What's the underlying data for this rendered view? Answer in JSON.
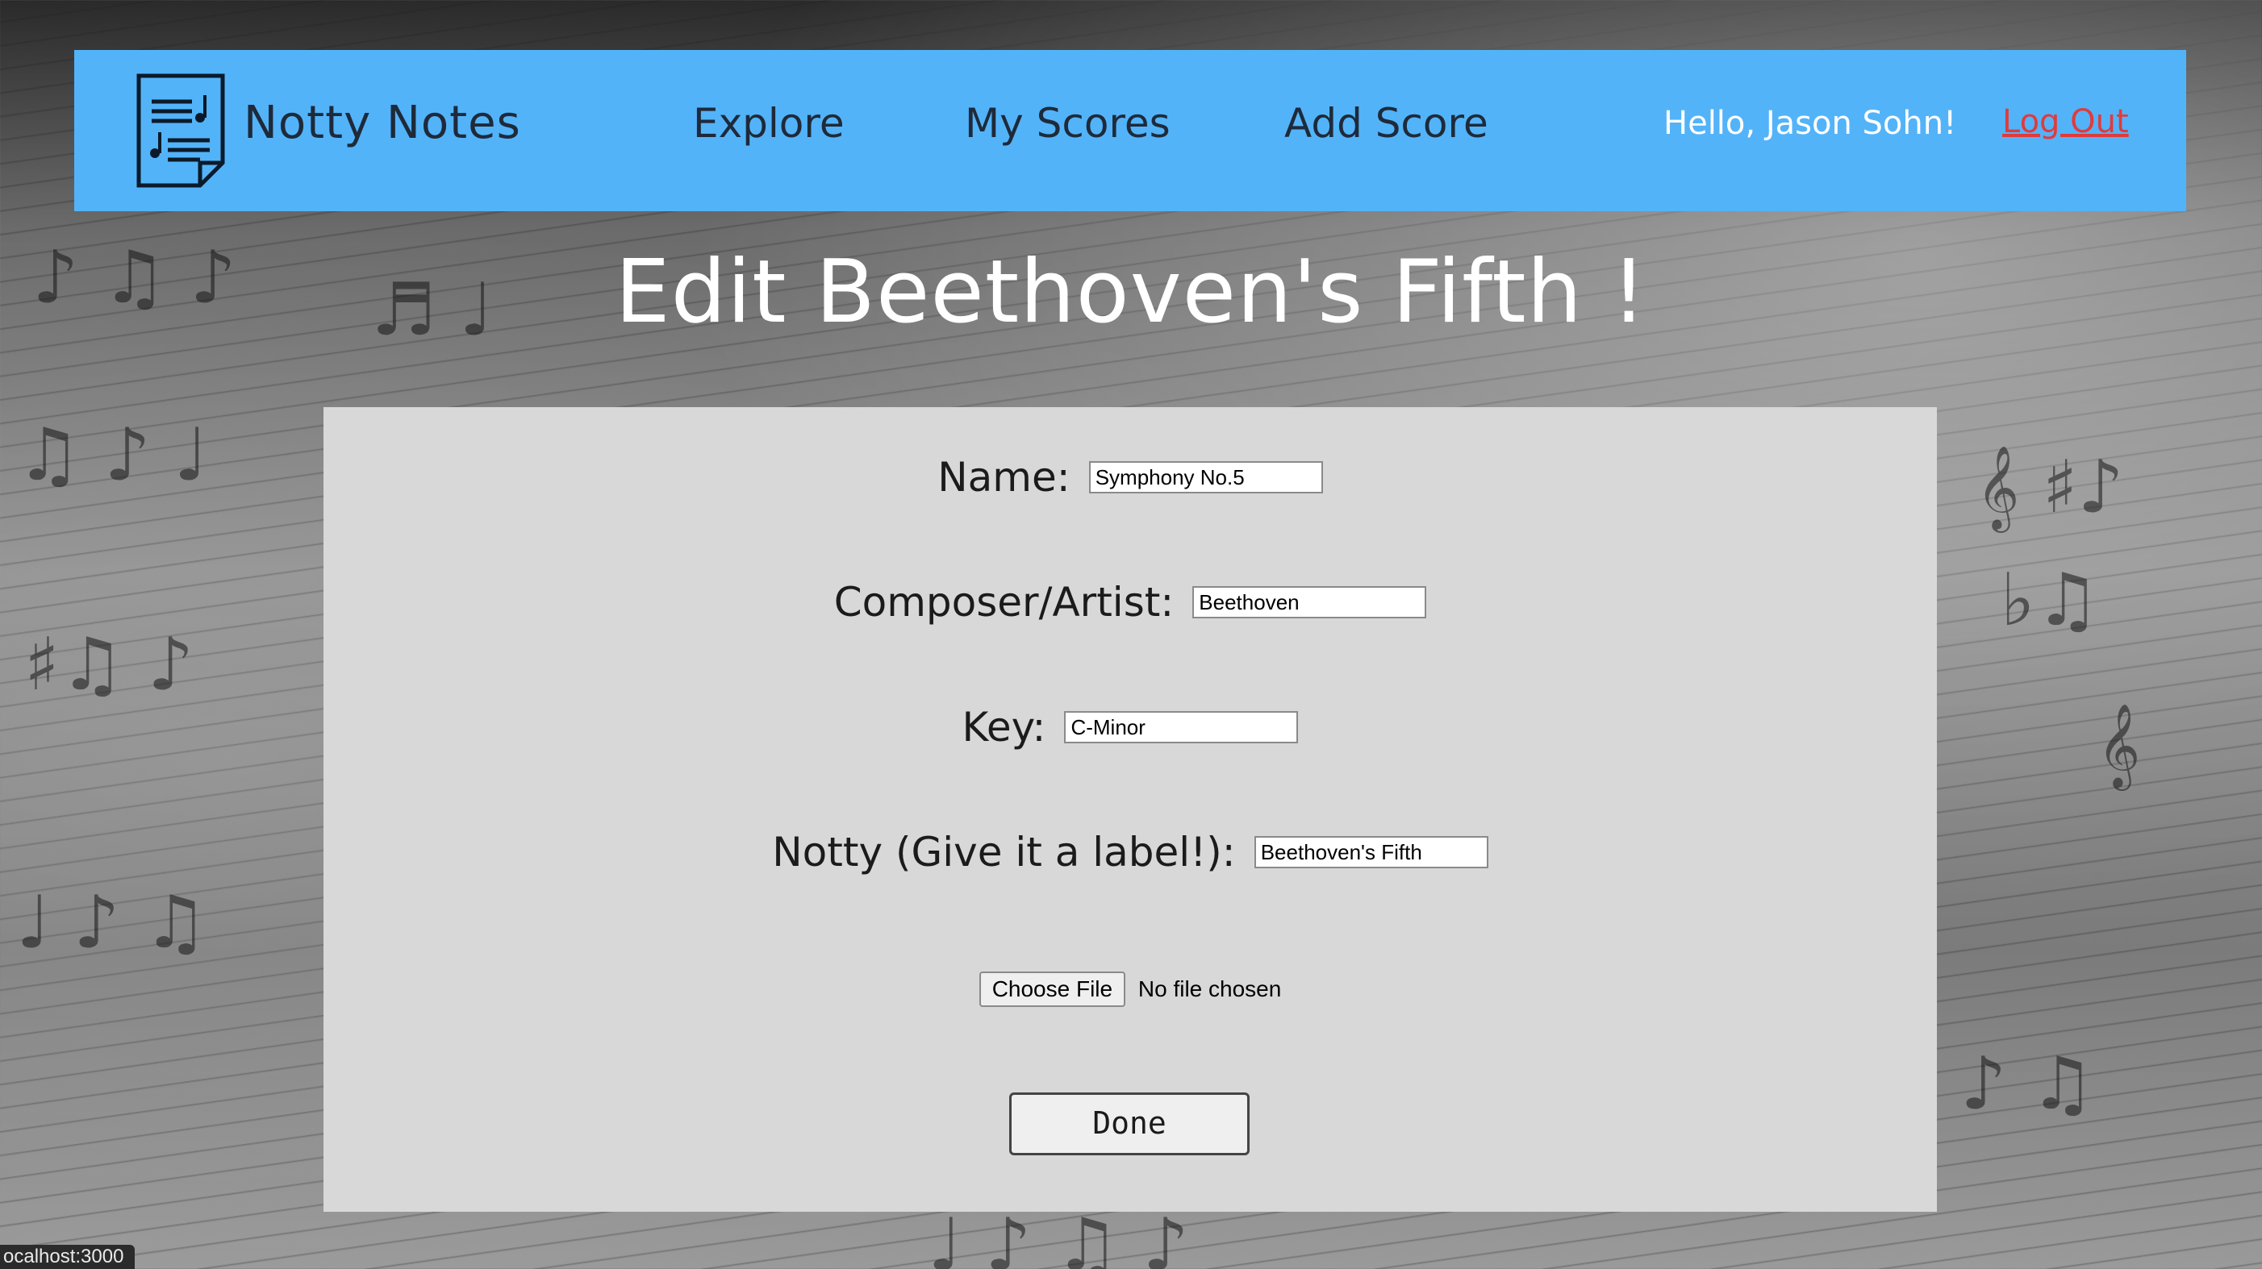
{
  "colors": {
    "navbar": "#53b3f9",
    "logout": "#e03b3b",
    "card": "#d8d8d8"
  },
  "header": {
    "brand": "Notty Notes",
    "logo_icon": "sheet-music-icon",
    "nav": [
      "Explore",
      "My Scores",
      "Add Score"
    ],
    "greeting": "Hello, Jason Sohn!",
    "logout": "Log Out"
  },
  "page": {
    "title": "Edit Beethoven's Fifth !"
  },
  "form": {
    "fields": [
      {
        "label": "Name:",
        "value": "Symphony No.5"
      },
      {
        "label": "Composer/Artist:",
        "value": "Beethoven"
      },
      {
        "label": "Key:",
        "value": "C-Minor"
      },
      {
        "label": "Notty (Give it a label!):",
        "value": "Beethoven's Fifth"
      }
    ],
    "file_button": "Choose File",
    "file_status": "No file chosen",
    "submit": "Done"
  },
  "status_bar": {
    "url": "ocalhost:3000"
  }
}
